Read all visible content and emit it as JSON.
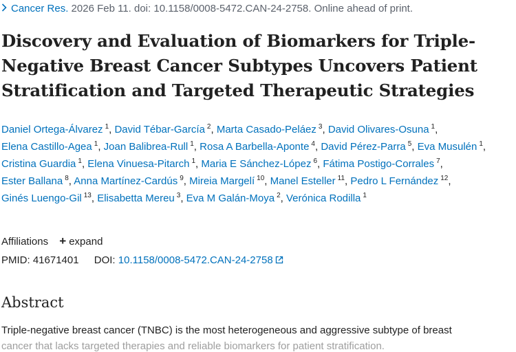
{
  "citation": {
    "journal": "Cancer Res.",
    "rest": " 2026 Feb 11. doi: 10.1158/0008-5472.CAN-24-2758. Online ahead of print."
  },
  "title": "Discovery and Evaluation of Biomarkers for Triple-Negative Breast Cancer Subtypes Uncovers Patient Stratification and Targeted Therapeutic Strategies",
  "authors": [
    {
      "name": "Daniel Ortega-Álvarez",
      "aff": "1"
    },
    {
      "name": "David Tébar-García",
      "aff": "2"
    },
    {
      "name": "Marta Casado-Peláez",
      "aff": "3"
    },
    {
      "name": "David Olivares-Osuna",
      "aff": "1"
    },
    {
      "name": "Elena Castillo-Agea",
      "aff": "1"
    },
    {
      "name": "Joan Balibrea-Rull",
      "aff": "1"
    },
    {
      "name": "Rosa A Barbella-Aponte",
      "aff": "4"
    },
    {
      "name": "David Pérez-Parra",
      "aff": "5"
    },
    {
      "name": "Eva Musulén",
      "aff": "1"
    },
    {
      "name": "Cristina Guardia",
      "aff": "1"
    },
    {
      "name": "Elena Vinuesa-Pitarch",
      "aff": "1"
    },
    {
      "name": "Maria E Sánchez-López",
      "aff": "6"
    },
    {
      "name": "Fátima Postigo-Corrales",
      "aff": "7"
    },
    {
      "name": "Ester Ballana",
      "aff": "8"
    },
    {
      "name": "Anna Martínez-Cardús",
      "aff": "9"
    },
    {
      "name": "Mireia Margelí",
      "aff": "10"
    },
    {
      "name": "Manel Esteller",
      "aff": "11"
    },
    {
      "name": "Pedro L Fernández",
      "aff": "12"
    },
    {
      "name": "Ginés Luengo-Gil",
      "aff": "13"
    },
    {
      "name": "Elisabetta Mereu",
      "aff": "3"
    },
    {
      "name": "Eva M Galán-Moya",
      "aff": "2"
    },
    {
      "name": "Verónica Rodilla",
      "aff": "1"
    }
  ],
  "affiliations": {
    "label": "Affiliations",
    "expand_label": "expand"
  },
  "ids": {
    "pmid_label": "PMID:",
    "pmid": "41671401",
    "doi_label": "DOI:",
    "doi": "10.1158/0008-5472.CAN-24-2758"
  },
  "abstract": {
    "heading": "Abstract",
    "line1": "Triple-negative breast cancer (TNBC) is the most heterogeneous and aggressive subtype of breast",
    "line2": "cancer that lacks targeted therapies and reliable biomarkers for patient stratification."
  },
  "colors": {
    "link": "#0071bc",
    "text": "#212121",
    "muted": "#5b616b"
  },
  "icons": [
    "chevron-right-icon",
    "plus-icon",
    "external-link-icon"
  ]
}
